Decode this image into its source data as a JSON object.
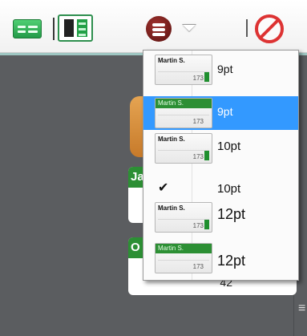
{
  "toolbar": {
    "buttons": [
      {
        "name": "view-mode-a",
        "icon": "layout-rows-icon"
      },
      {
        "name": "view-mode-b",
        "icon": "layout-split-icon"
      },
      {
        "name": "menu-button",
        "icon": "hamburger-circle-icon"
      },
      {
        "name": "dropdown-caret",
        "icon": "chevron-down-icon"
      },
      {
        "name": "disable-button",
        "icon": "prohibited-icon"
      }
    ]
  },
  "background": {
    "card1_initial": "Ja",
    "card2_initial": "O",
    "card2_value": "42",
    "scroll_glyph": "≡"
  },
  "dropdown": {
    "check_mark": "✔",
    "items": [
      {
        "thumb_name": "Martin S.",
        "thumb_value": "173",
        "style": "white",
        "label": "9pt"
      },
      {
        "thumb_name": "Martin S.",
        "thumb_value": "173",
        "style": "green",
        "label": "9pt",
        "selected": true
      },
      {
        "thumb_name": "Martin S.",
        "thumb_value": "173",
        "style": "white",
        "label": "10pt"
      },
      {
        "thumb_name": "",
        "thumb_value": "",
        "style": "none",
        "label": "10pt",
        "checked": true
      },
      {
        "thumb_name": "Martin S.",
        "thumb_value": "173",
        "style": "white",
        "label": "12pt"
      },
      {
        "thumb_name": "Martin S.",
        "thumb_value": "173",
        "style": "green",
        "label": "12pt"
      }
    ]
  },
  "colors": {
    "selection": "#3399ff",
    "accent_green": "#2c8f34",
    "orange": "#e5a452"
  }
}
